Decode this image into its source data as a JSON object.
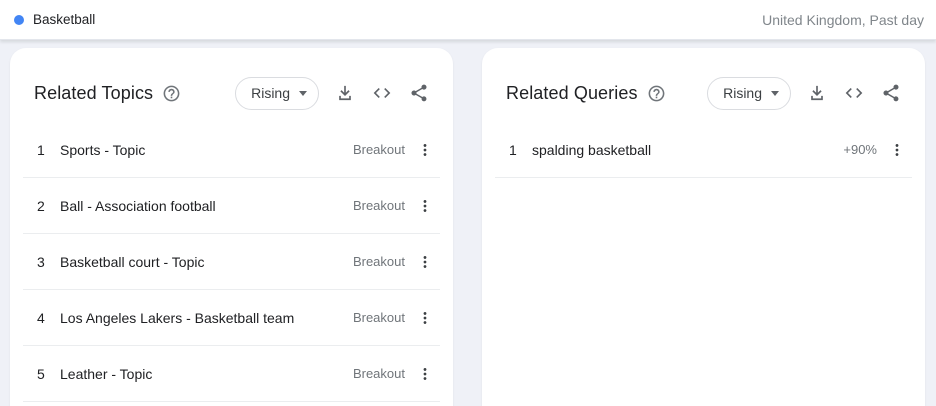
{
  "topbar": {
    "term": "Basketball",
    "scope": "United Kingdom, Past day"
  },
  "panels": [
    {
      "title": "Related Topics",
      "sort_label": "Rising",
      "rows": [
        {
          "rank": "1",
          "label": "Sports - Topic",
          "value": "Breakout"
        },
        {
          "rank": "2",
          "label": "Ball - Association football",
          "value": "Breakout"
        },
        {
          "rank": "3",
          "label": "Basketball court - Topic",
          "value": "Breakout"
        },
        {
          "rank": "4",
          "label": "Los Angeles Lakers - Basketball team",
          "value": "Breakout"
        },
        {
          "rank": "5",
          "label": "Leather - Topic",
          "value": "Breakout"
        }
      ]
    },
    {
      "title": "Related Queries",
      "sort_label": "Rising",
      "rows": [
        {
          "rank": "1",
          "label": "spalding basketball",
          "value": "+90%"
        }
      ]
    }
  ],
  "icons": {
    "term_dot": "blue-bullet",
    "help": "question-mark-circle",
    "sort_caret": "caret-down",
    "download": "download-tray-arrow",
    "embed": "code-angle-brackets",
    "share": "share-nodes",
    "row_menu": "three-dot-vertical-menu"
  },
  "colors": {
    "page_background": "#eff1f7",
    "card_background": "#ffffff",
    "term_dot": "#4285f4",
    "primary_text": "#202124",
    "secondary_text": "#70757a",
    "icon_gray": "#5f6368",
    "divider": "#ebedef",
    "button_border": "#dadce0"
  }
}
